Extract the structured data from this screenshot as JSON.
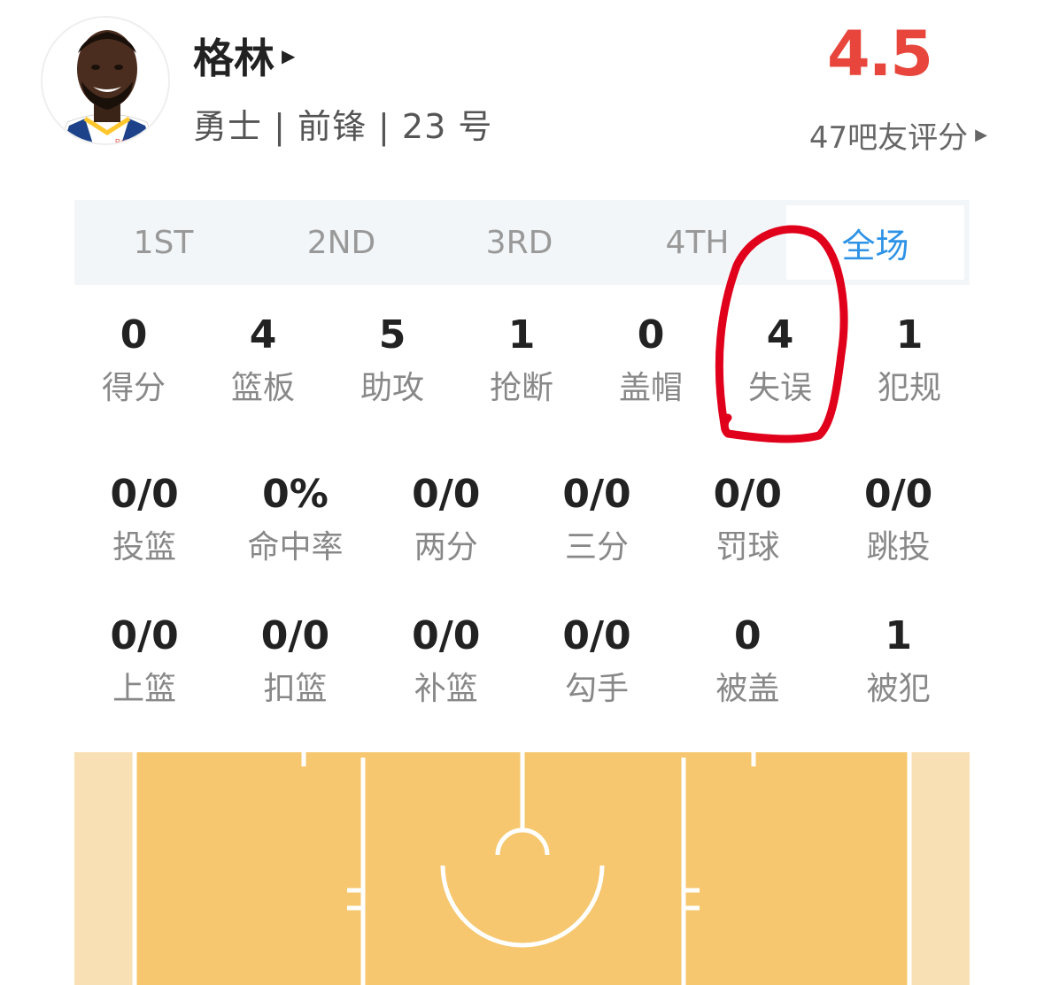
{
  "player": {
    "name": "格林",
    "info": "勇士 | 前锋 | 23 号"
  },
  "rating": {
    "score": "4.5",
    "raters": "47吧友评分"
  },
  "tabs": [
    {
      "label": "1ST",
      "active": false
    },
    {
      "label": "2ND",
      "active": false
    },
    {
      "label": "3RD",
      "active": false
    },
    {
      "label": "4TH",
      "active": false
    },
    {
      "label": "全场",
      "active": true
    }
  ],
  "stats_main": [
    {
      "value": "0",
      "label": "得分"
    },
    {
      "value": "4",
      "label": "篮板"
    },
    {
      "value": "5",
      "label": "助攻"
    },
    {
      "value": "1",
      "label": "抢断"
    },
    {
      "value": "0",
      "label": "盖帽"
    },
    {
      "value": "4",
      "label": "失误"
    },
    {
      "value": "1",
      "label": "犯规"
    }
  ],
  "stats_shooting": [
    {
      "value": "0/0",
      "label": "投篮"
    },
    {
      "value": "0%",
      "label": "命中率"
    },
    {
      "value": "0/0",
      "label": "两分"
    },
    {
      "value": "0/0",
      "label": "三分"
    },
    {
      "value": "0/0",
      "label": "罚球"
    },
    {
      "value": "0/0",
      "label": "跳投"
    }
  ],
  "stats_other": [
    {
      "value": "0/0",
      "label": "上篮"
    },
    {
      "value": "0/0",
      "label": "扣篮"
    },
    {
      "value": "0/0",
      "label": "补篮"
    },
    {
      "value": "0/0",
      "label": "勾手"
    },
    {
      "value": "0",
      "label": "被盖"
    },
    {
      "value": "1",
      "label": "被犯"
    }
  ],
  "colors": {
    "rating": "#e8463c",
    "active_tab": "#2e93e6",
    "court": "#f6c76f",
    "court_edge": "#f9dfb4",
    "annotation": "#e0001b"
  }
}
